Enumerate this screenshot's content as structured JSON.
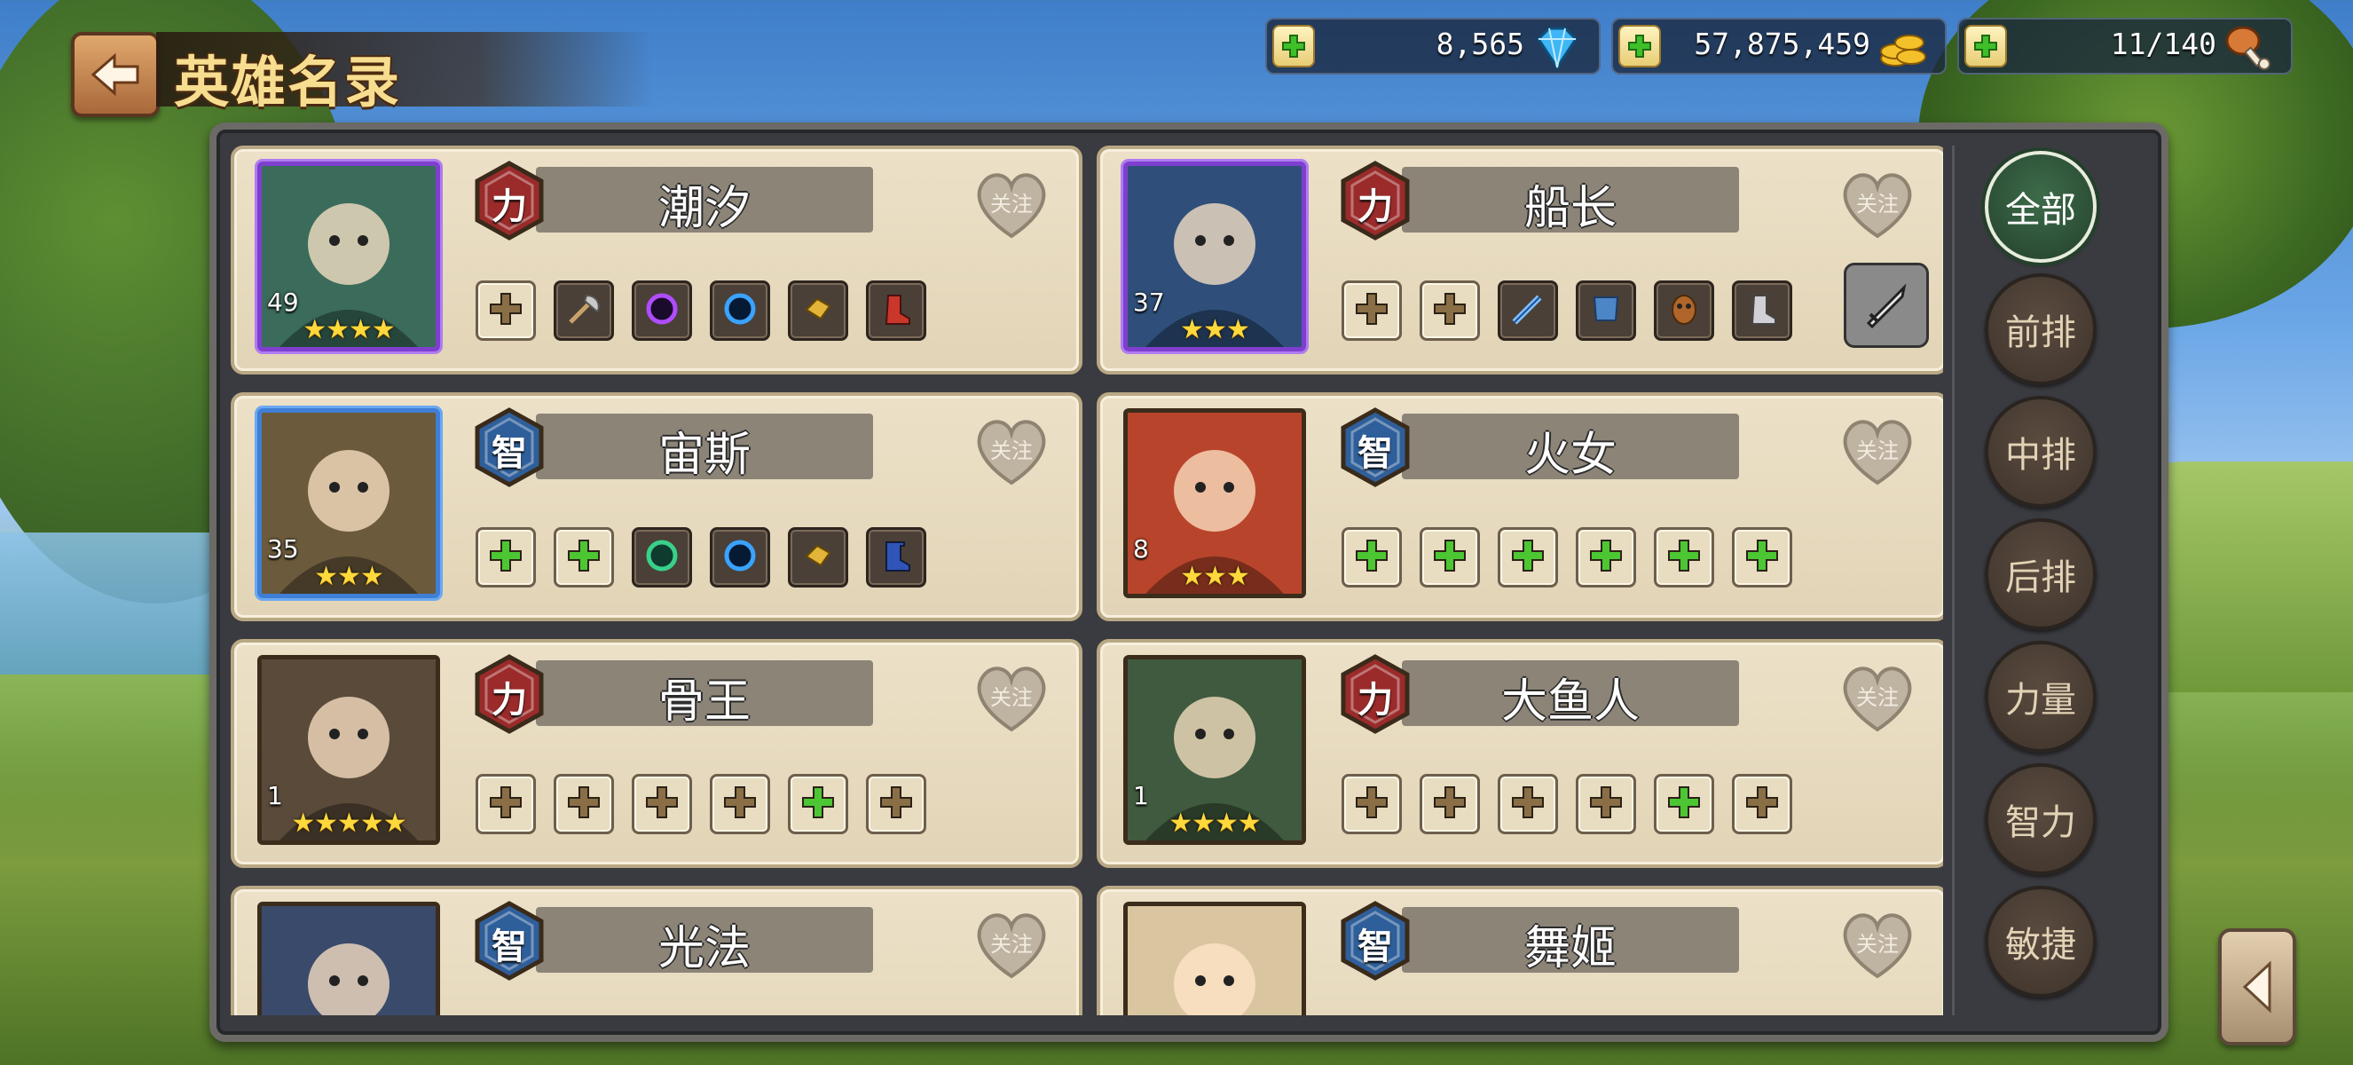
{
  "header": {
    "title": "英雄名录"
  },
  "resources": [
    {
      "value": "8,565",
      "icon": "diamond-icon",
      "color": "#3fb6f5"
    },
    {
      "value": "57,875,459",
      "icon": "gold-coin-icon",
      "color": "#f4c12a"
    },
    {
      "value": "11/140",
      "icon": "meat-drumstick-icon",
      "color": "#d77a37"
    }
  ],
  "follow_label": "关注",
  "heroes": [
    {
      "name": "潮汐",
      "class": "力",
      "level": "49",
      "stars": "★★★★",
      "frame": "purple",
      "slots": [
        "plus-beige",
        "axe-icon",
        "purple-orb-icon",
        "blue-orb-icon",
        "gold-item-icon",
        "red-boot-icon"
      ]
    },
    {
      "name": "船长",
      "class": "力",
      "level": "37",
      "stars": "★★★",
      "frame": "purple",
      "slots": [
        "plus-beige",
        "plus-beige",
        "blue-sword-icon",
        "blue-armor-icon",
        "bronze-mask-icon",
        "silver-boot-icon"
      ],
      "has_weapon_button": true
    },
    {
      "name": "宙斯",
      "class": "智",
      "level": "35",
      "stars": "★★★",
      "frame": "blue",
      "slots": [
        "plus-green",
        "plus-green",
        "green-orb-icon",
        "blue-orb-icon",
        "gold-item-icon",
        "blue-boot-icon"
      ]
    },
    {
      "name": "火女",
      "class": "智",
      "level": "8",
      "stars": "★★★",
      "frame": "plain",
      "slots": [
        "plus-green",
        "plus-green",
        "plus-green",
        "plus-green",
        "plus-green",
        "plus-green"
      ]
    },
    {
      "name": "骨王",
      "class": "力",
      "level": "1",
      "stars": "★★★★★",
      "frame": "plain",
      "slots": [
        "plus-beige",
        "plus-beige",
        "plus-beige",
        "plus-beige",
        "plus-green",
        "plus-beige"
      ]
    },
    {
      "name": "大鱼人",
      "class": "力",
      "level": "1",
      "stars": "★★★★",
      "frame": "plain",
      "slots": [
        "plus-beige",
        "plus-beige",
        "plus-beige",
        "plus-beige",
        "plus-green",
        "plus-beige"
      ]
    },
    {
      "name": "光法",
      "class": "智",
      "level": "",
      "stars": "",
      "frame": "plain",
      "slots": []
    },
    {
      "name": "舞姬",
      "class": "智",
      "level": "",
      "stars": "",
      "frame": "plain",
      "slots": []
    }
  ],
  "filter_tabs": [
    "全部",
    "前排",
    "中排",
    "后排",
    "力量",
    "智力",
    "敏捷"
  ],
  "active_tab": "全部",
  "class_colors": {
    "力": "#9a2b2a",
    "智": "#2f5f9a"
  },
  "portrait_palettes": [
    "#3b6b5b",
    "#2f4f7a",
    "#6b5a3c",
    "#b8452b",
    "#5a4a3a",
    "#3f5a3f",
    "#3a4a6a",
    "#d9c6a0"
  ]
}
